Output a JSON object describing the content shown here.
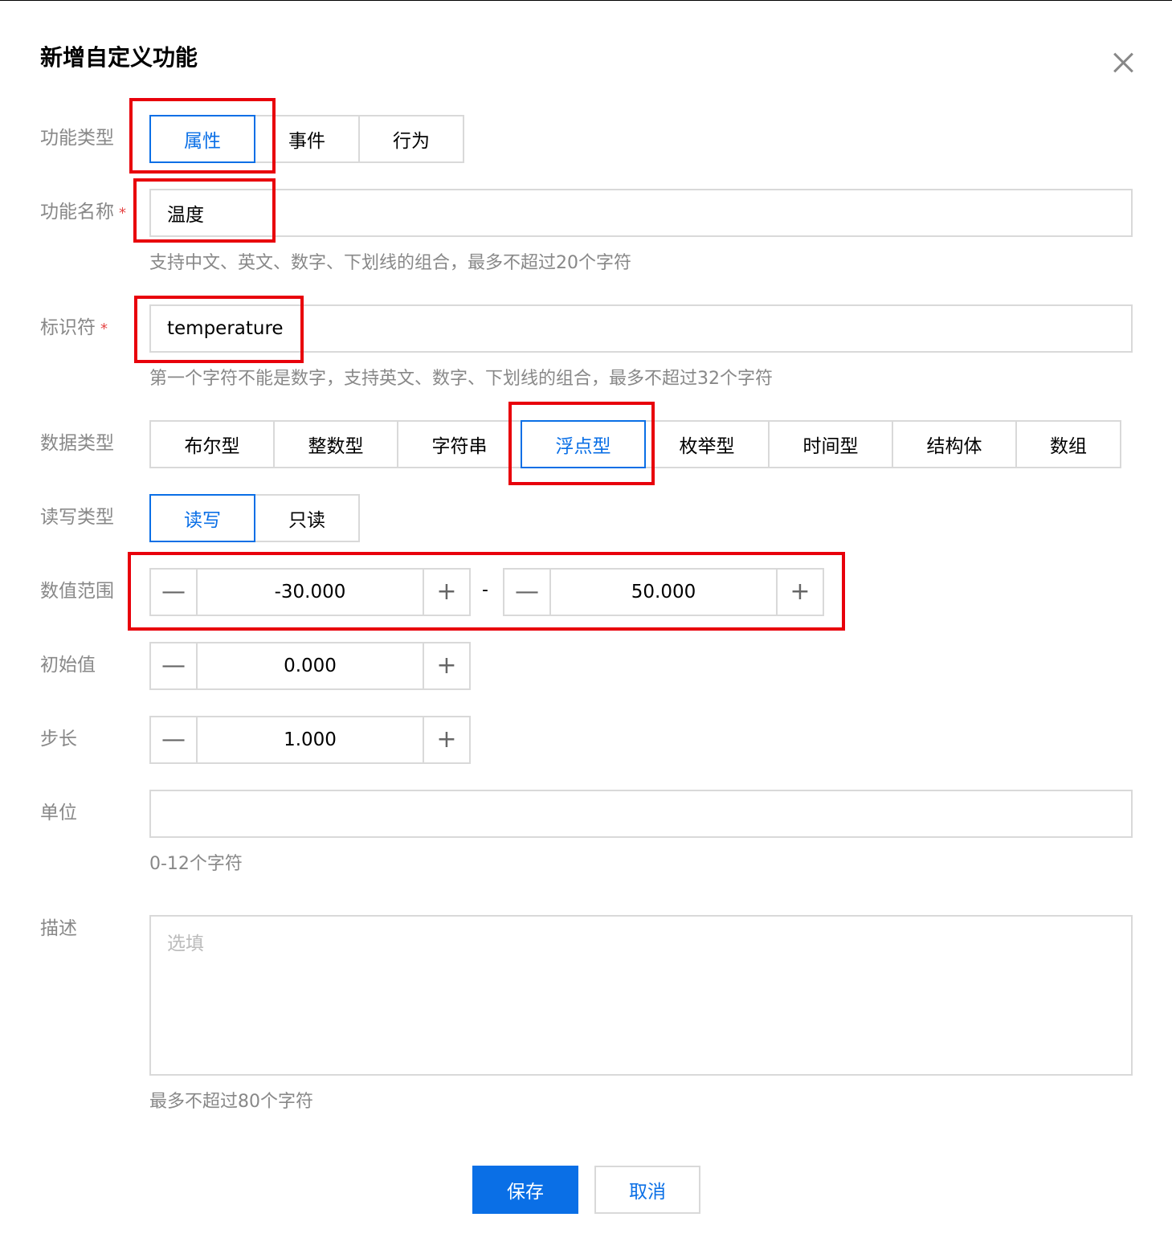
{
  "dialog": {
    "title": "新增自定义功能",
    "close_icon": "close-icon"
  },
  "form": {
    "func_type": {
      "label": "功能类型",
      "options": [
        "属性",
        "事件",
        "行为"
      ],
      "selected": "属性"
    },
    "func_name": {
      "label": "功能名称",
      "required_mark": "*",
      "value": "温度",
      "hint": "支持中文、英文、数字、下划线的组合，最多不超过20个字符"
    },
    "identifier": {
      "label": "标识符",
      "required_mark": "*",
      "value": "temperature",
      "hint": "第一个字符不能是数字，支持英文、数字、下划线的组合，最多不超过32个字符"
    },
    "data_type": {
      "label": "数据类型",
      "options": [
        "布尔型",
        "整数型",
        "字符串",
        "浮点型",
        "枚举型",
        "时间型",
        "结构体",
        "数组"
      ],
      "selected": "浮点型"
    },
    "rw_type": {
      "label": "读写类型",
      "options": [
        "读写",
        "只读"
      ],
      "selected": "读写"
    },
    "range": {
      "label": "数值范围",
      "min": "-30.000",
      "separator": "-",
      "max": "50.000"
    },
    "initial": {
      "label": "初始值",
      "value": "0.000"
    },
    "step": {
      "label": "步长",
      "value": "1.000"
    },
    "unit": {
      "label": "单位",
      "value": "",
      "hint": "0-12个字符"
    },
    "description": {
      "label": "描述",
      "placeholder": "选填",
      "hint": "最多不超过80个字符"
    }
  },
  "stepper_symbols": {
    "minus": "—",
    "plus": "+"
  },
  "footer": {
    "save_label": "保存",
    "cancel_label": "取消"
  },
  "colors": {
    "accent": "#0a6fe6",
    "highlight": "#e8000b",
    "border": "#d9d9d9",
    "label": "#888888"
  }
}
